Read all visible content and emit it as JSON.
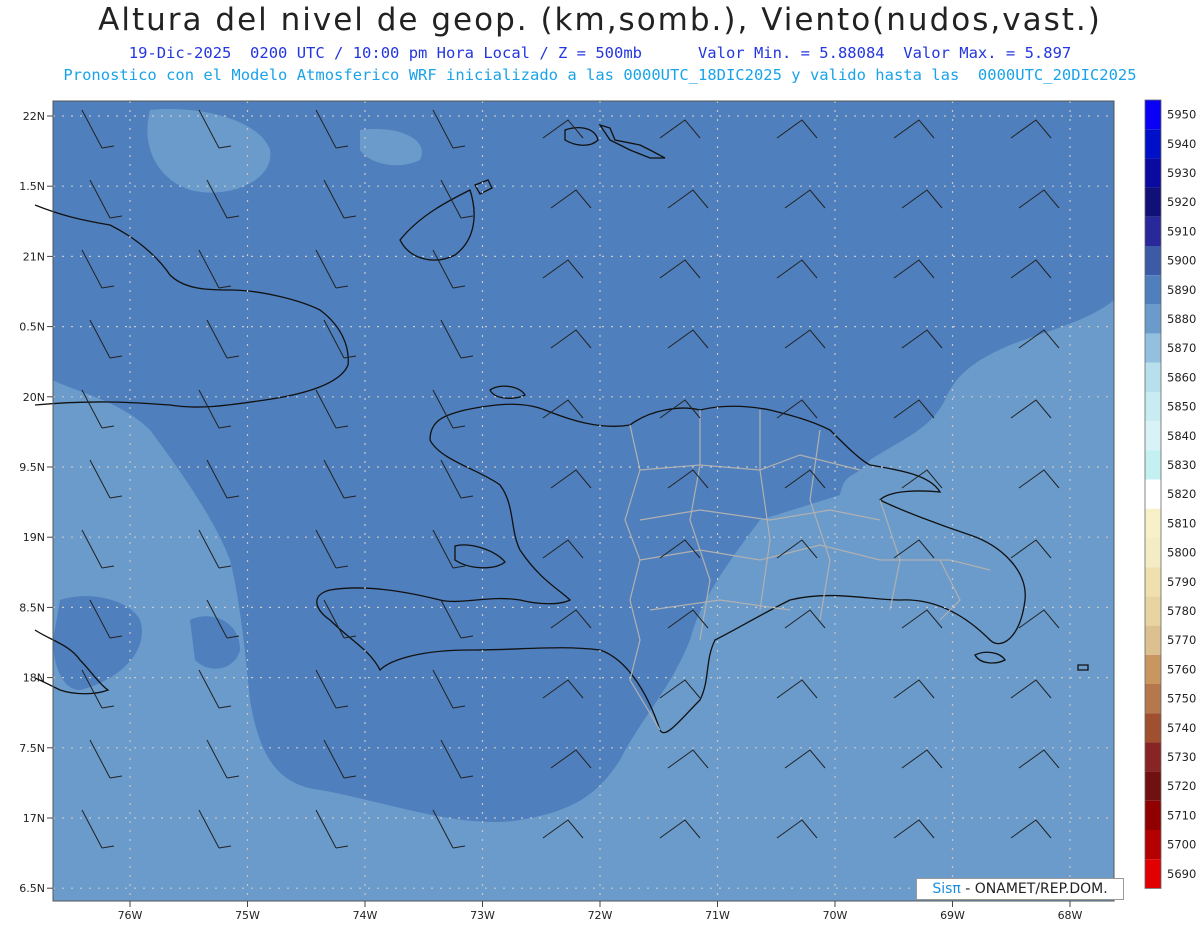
{
  "header": {
    "title": "Altura del nivel de geop. (km,somb.), Viento(nudos,vast.)",
    "line1": "19-Dic-2025  0200 UTC / 10:00 pm Hora Local / Z = 500mb      Valor Min. = 5.88084  Valor Max. = 5.897",
    "line2": "Pronostico con el Modelo Atmosferico WRF inicializado a las 0000UTC_18DIC2025 y valido hasta las  0000UTC_20DIC2025"
  },
  "axes": {
    "lat_labels": [
      "22N",
      "1.5N",
      "21N",
      "0.5N",
      "20N",
      "9.5N",
      "19N",
      "8.5N",
      "18N",
      "7.5N",
      "17N",
      "6.5N"
    ],
    "lon_labels": [
      "76W",
      "75W",
      "74W",
      "73W",
      "72W",
      "71W",
      "70W",
      "69W",
      "68W"
    ]
  },
  "colorbar": {
    "levels": [
      "5950",
      "5940",
      "5930",
      "5920",
      "5910",
      "5900",
      "5890",
      "5880",
      "5870",
      "5860",
      "5850",
      "5840",
      "5830",
      "5820",
      "5810",
      "5800",
      "5790",
      "5780",
      "5770",
      "5760",
      "5750",
      "5740",
      "5730",
      "5720",
      "5710",
      "5700",
      "5690"
    ],
    "colors": [
      "#0a00f5",
      "#0010c8",
      "#0a0aa0",
      "#101078",
      "#28289a",
      "#3c5aa6",
      "#4f7fbc",
      "#6a9bcb",
      "#94c0e0",
      "#b8e0ec",
      "#c8ecf2",
      "#d8f2f6",
      "#c4f0f2",
      "#ffffff",
      "#f8f0c8",
      "#f4ecc4",
      "#f0e0b0",
      "#e8d4a0",
      "#dcc090",
      "#c8965e",
      "#b4784c",
      "#a0502e",
      "#882424",
      "#701010",
      "#900000",
      "#b40000",
      "#e00000"
    ]
  },
  "credit": {
    "a": "Sisπ",
    "b": "- ONAMET/REP.DOM."
  },
  "colors": {
    "field_dark": "#4f7fbc",
    "field_light": "#6a9bcb",
    "coast": "#111111",
    "provinces": "#b0b0b0"
  }
}
